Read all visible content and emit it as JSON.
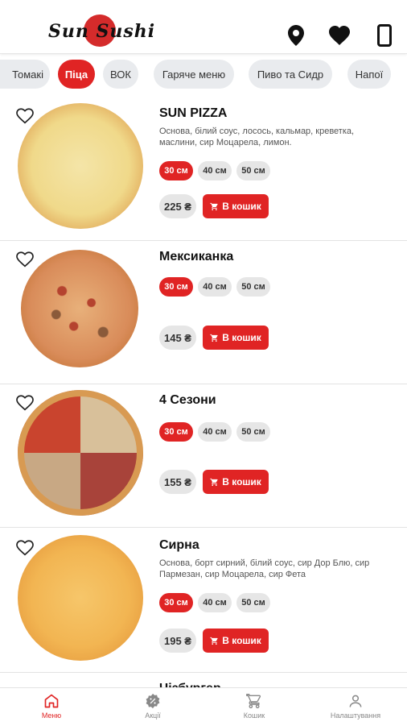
{
  "header": {
    "logo_text": "Sun Sushi",
    "icons": [
      "location-pin-icon",
      "heart-icon",
      "phone-icon"
    ]
  },
  "tabs": [
    {
      "label": "Томакі",
      "active": false
    },
    {
      "label": "Піца",
      "active": true
    },
    {
      "label": "ВОК",
      "active": false
    },
    {
      "label": "Гаряче меню",
      "active": false
    },
    {
      "label": "Пиво та Сидр",
      "active": false
    },
    {
      "label": "Напої",
      "active": false
    }
  ],
  "products": [
    {
      "title": "SUN PIZZA",
      "description": "Основа, білий соус, лосось, кальмар, креветка, маслини, сир Моцарела, лимон.",
      "sizes": [
        "30 см",
        "40 см",
        "50 см"
      ],
      "price": "225 ₴",
      "cart_label": "В кошик"
    },
    {
      "title": "Мексиканка",
      "description": "",
      "sizes": [
        "30 см",
        "40 см",
        "50 см"
      ],
      "price": "145 ₴",
      "cart_label": "В кошик"
    },
    {
      "title": "4 Сезони",
      "description": "",
      "sizes": [
        "30 см",
        "40 см",
        "50 см"
      ],
      "price": "155 ₴",
      "cart_label": "В кошик"
    },
    {
      "title": "Сирна",
      "description": "Основа, борт сирний, білий соус, сир Дор Блю, сир Пармезан, сир Моцарела, сир Фета",
      "sizes": [
        "30 см",
        "40 см",
        "50 см"
      ],
      "price": "195 ₴",
      "cart_label": "В кошик"
    }
  ],
  "partial_next_title": "Чізбургер",
  "bottom_nav": [
    {
      "label": "Меню",
      "icon": "home-icon",
      "active": true
    },
    {
      "label": "Акції",
      "icon": "discount-badge-icon",
      "active": false
    },
    {
      "label": "Кошик",
      "icon": "cart-icon",
      "active": false
    },
    {
      "label": "Налаштування",
      "icon": "user-icon",
      "active": false
    }
  ],
  "colors": {
    "accent": "#e02424",
    "chip": "#e6e6e6",
    "tab": "#e9ebee"
  }
}
